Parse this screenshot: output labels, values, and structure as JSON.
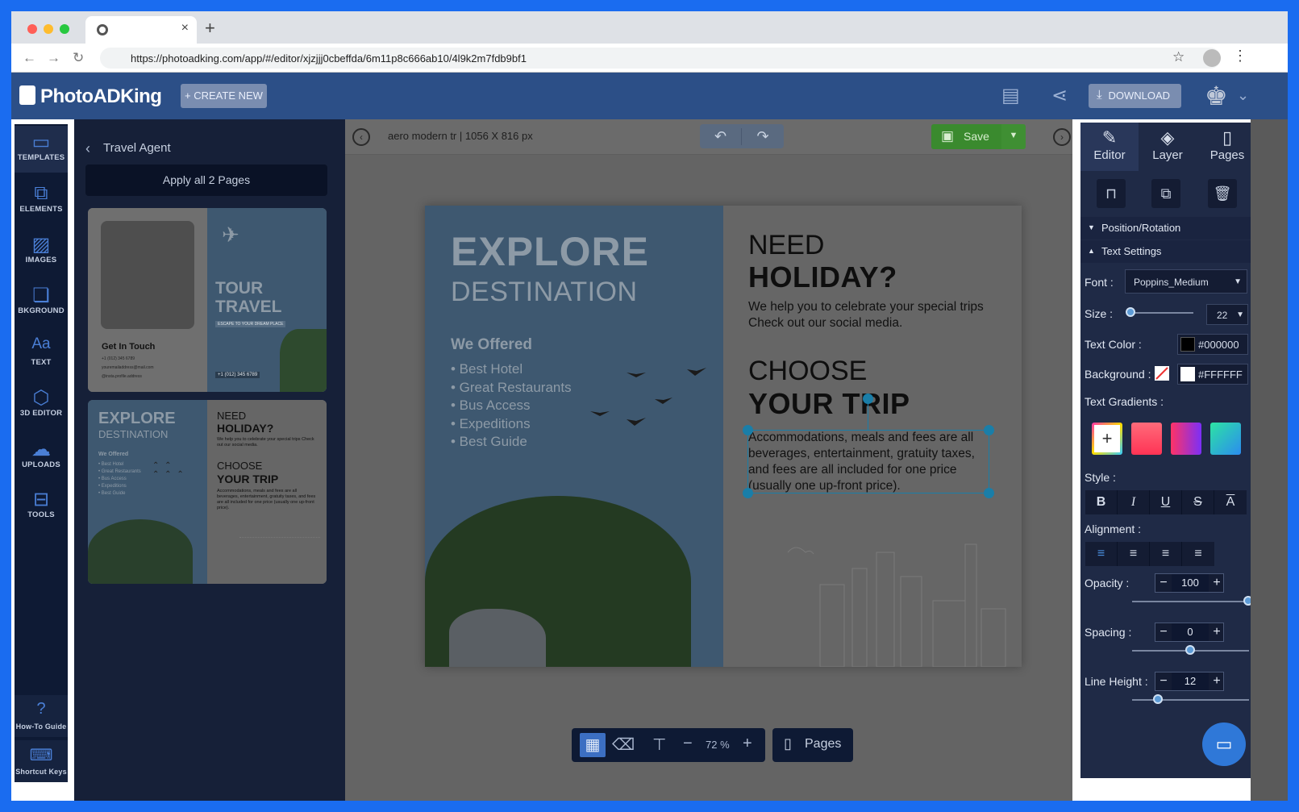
{
  "browser": {
    "url": "https://photoadking.com/app/#/editor/xjzjjj0cbeffda/6m11p8c666ab10/4l9k2m7fdb9bf1",
    "new_tab": "+",
    "tab_close": "×"
  },
  "app": {
    "logo": "PhotoADKing",
    "create_new": "+ CREATE NEW",
    "download": "DOWNLOAD"
  },
  "rail": {
    "items": [
      {
        "label": "TEMPLATES",
        "icon": "template-icon"
      },
      {
        "label": "ELEMENTS",
        "icon": "elements-icon"
      },
      {
        "label": "IMAGES",
        "icon": "image-icon"
      },
      {
        "label": "BKGROUND",
        "icon": "background-icon"
      },
      {
        "label": "TEXT",
        "icon": "text-icon"
      },
      {
        "label": "3D EDITOR",
        "icon": "cube-icon"
      },
      {
        "label": "UPLOADS",
        "icon": "upload-icon"
      },
      {
        "label": "TOOLS",
        "icon": "toolbox-icon"
      }
    ],
    "bottom": [
      {
        "label": "How-To Guide",
        "icon": "help-icon"
      },
      {
        "label": "Shortcut Keys",
        "icon": "keyboard-icon"
      }
    ]
  },
  "templates": {
    "title": "Travel Agent",
    "apply_all": "Apply all 2 Pages",
    "thumb1": {
      "tour": "TOUR",
      "travel": "TRAVEL",
      "escape": "ESCAPE TO YOUR DREAM PLACE",
      "phone": "+1 (012) 345 6789",
      "get_in_touch": "Get In Touch",
      "contact1": "+1 (012) 345 6789",
      "contact2": "youremailaddress@mail.com",
      "contact3": "@insta.profile.address"
    },
    "thumb2": {
      "explore": "EXPLORE",
      "destination": "DESTINATION",
      "offered": "We Offered",
      "list": [
        "• Best Hotel",
        "• Great Restaurants",
        "• Bus Access",
        "• Expeditions",
        "• Best Guide"
      ],
      "need": "NEED",
      "holiday": "HOLIDAY?",
      "desc1": "We help you to celebrate your special trips Check out our social media.",
      "choose": "CHOOSE",
      "your_trip": "YOUR TRIP",
      "desc2": "Accommodations, meals and fees are all beverages, entertainment, gratuity taxes, and fees are all included for one price (usually one up-front price)."
    }
  },
  "canvas": {
    "doc_name": "aero modern tr",
    "doc_size": "1056 X 816 px",
    "save": "Save",
    "zoom": "72 %",
    "pages": "Pages",
    "design": {
      "explore": "EXPLORE",
      "destination": "DESTINATION",
      "offered": "We Offered",
      "list": [
        "• Best Hotel",
        "• Great Restaurants",
        "• Bus Access",
        "• Expeditions",
        "• Best Guide"
      ],
      "need": "NEED",
      "holiday": "HOLIDAY?",
      "desc1": "We help you to celebrate your special trips Check out our social media.",
      "choose": "CHOOSE",
      "your_trip": "YOUR TRIP",
      "desc2": "Accommodations, meals and fees are all beverages, entertainment, gratuity taxes, and fees are all included for one price (usually one up-front price)."
    }
  },
  "right_panel": {
    "tabs": [
      "Editor",
      "Layer",
      "Pages"
    ],
    "position_rotation": "Position/Rotation",
    "text_settings": "Text Settings",
    "font_label": "Font :",
    "font_value": "Poppins_Medium",
    "size_label": "Size :",
    "size_value": "22",
    "size_fraction": 0.0,
    "text_color_label": "Text Color :",
    "text_color": "#000000",
    "background_label": "Background :",
    "background_color": "#FFFFFF",
    "gradients_label": "Text Gradients :",
    "style_label": "Style :",
    "alignment_label": "Alignment :",
    "opacity_label": "Opacity :",
    "opacity_value": "100",
    "spacing_label": "Spacing :",
    "spacing_value": "0",
    "line_height_label": "Line Height :",
    "line_height_value": "12"
  },
  "colors": {
    "accent": "#1a6cf0",
    "header": "#2c4f87",
    "rail": "#0e1a34",
    "save_green": "#3a8a2e",
    "design_blue": "#3e5870"
  }
}
